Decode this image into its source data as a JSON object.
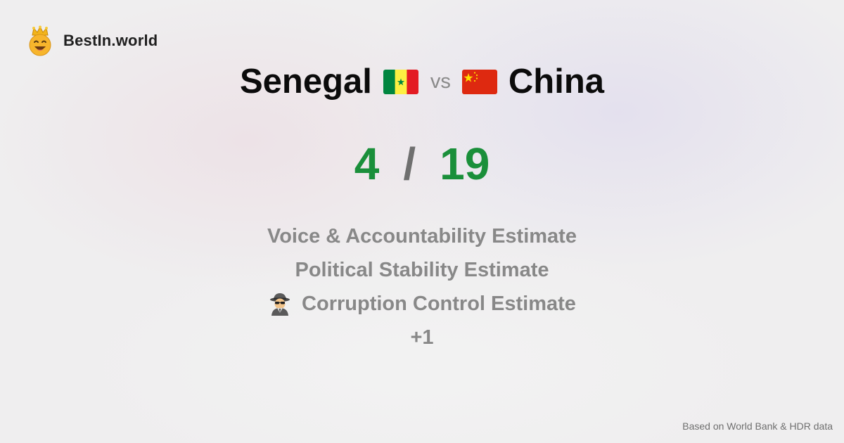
{
  "brand": {
    "name": "BestIn.world",
    "logo_icon": "crowned-smiley-icon"
  },
  "comparison": {
    "left_country": "Senegal",
    "left_flag": "senegal-flag-icon",
    "vs_label": "vs",
    "right_country": "China",
    "right_flag": "china-flag-icon"
  },
  "score": {
    "left": "4",
    "separator": "/",
    "right": "19"
  },
  "metrics": [
    {
      "label": "Voice & Accountability Estimate",
      "icon": ""
    },
    {
      "label": "Political Stability Estimate",
      "icon": ""
    },
    {
      "label": "Corruption Control Estimate",
      "icon": "spy-detective-icon"
    }
  ],
  "more_label": "+1",
  "footer": {
    "source": "Based on World Bank & HDR data"
  },
  "colors": {
    "score": "#1a8f3a",
    "muted_text": "#888888",
    "senegal": [
      "#00853f",
      "#fdef42",
      "#e31b23"
    ],
    "china": [
      "#de2910",
      "#ffde00"
    ]
  }
}
